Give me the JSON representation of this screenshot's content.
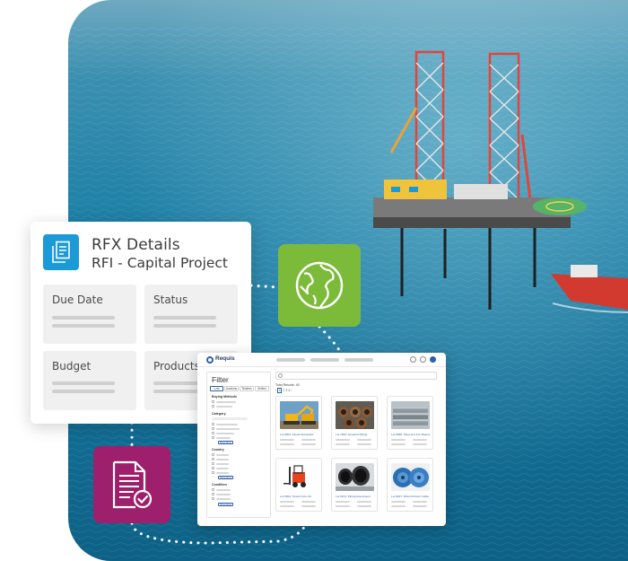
{
  "rfx_card": {
    "title": "RFX Details",
    "subtitle": "RFI - Capital Project",
    "fields": [
      "Due Date",
      "Status",
      "Budget",
      "Products"
    ],
    "doc_icon": "document-icon"
  },
  "tiles": {
    "globe_icon": "globe-icon",
    "document_check_icon": "document-check-icon"
  },
  "colors": {
    "rfx_icon_bg": "#1a9ad6",
    "globe_tile_bg": "#7cbb3a",
    "doc_check_tile_bg": "#9e1f6c",
    "brand_blue": "#2f5fa8"
  },
  "app": {
    "brand": "Requis",
    "filter": {
      "title": "Filter",
      "tabs": [
        "Lots",
        "Auctions",
        "Tenders",
        "Sellers"
      ],
      "sections": [
        "Buying Methods",
        "Category",
        "Country",
        "Condition"
      ],
      "show_more": "Show More"
    },
    "results_label": "Total Results: 45",
    "pager": [
      "1",
      "2",
      "3",
      "4"
    ],
    "products": [
      "Lot 8901: Kinwet Excavator",
      "Lot 7823: Assorted Piping",
      "Lot 6660: Steel and Iron Beams",
      "Lot 6601: Hyster Fork Lift",
      "Lot 6672: Piping Assortment",
      "Lot 6617: Wound Power Cable"
    ]
  }
}
